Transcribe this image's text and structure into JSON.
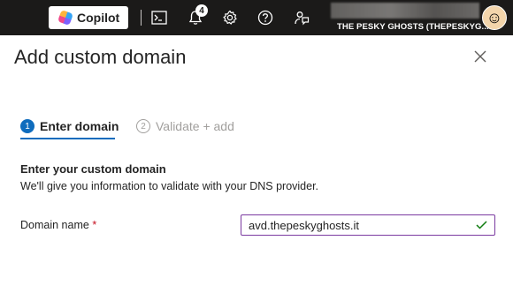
{
  "topbar": {
    "copilot_label": "Copilot",
    "notifications_count": "4",
    "account_name": "THE PESKY GHOSTS (THEPESKYG...",
    "icons": [
      "cloud-shell-icon",
      "notifications-icon",
      "settings-icon",
      "help-icon",
      "feedback-icon"
    ]
  },
  "panel": {
    "title": "Add custom domain",
    "steps": [
      {
        "number": "1",
        "label": "Enter domain",
        "active": true
      },
      {
        "number": "2",
        "label": "Validate + add",
        "active": false
      }
    ],
    "section_title": "Enter your custom domain",
    "section_desc": "We'll give you information to validate with your DNS provider.",
    "field": {
      "label": "Domain name",
      "required_marker": "*",
      "value": "avd.thepeskyghosts.it"
    }
  },
  "colors": {
    "topbar_bg": "#1b1a19",
    "accent": "#0f6cbd",
    "input_border": "#7a3aa0",
    "valid_check": "#107c10",
    "required": "#c50f1f"
  }
}
